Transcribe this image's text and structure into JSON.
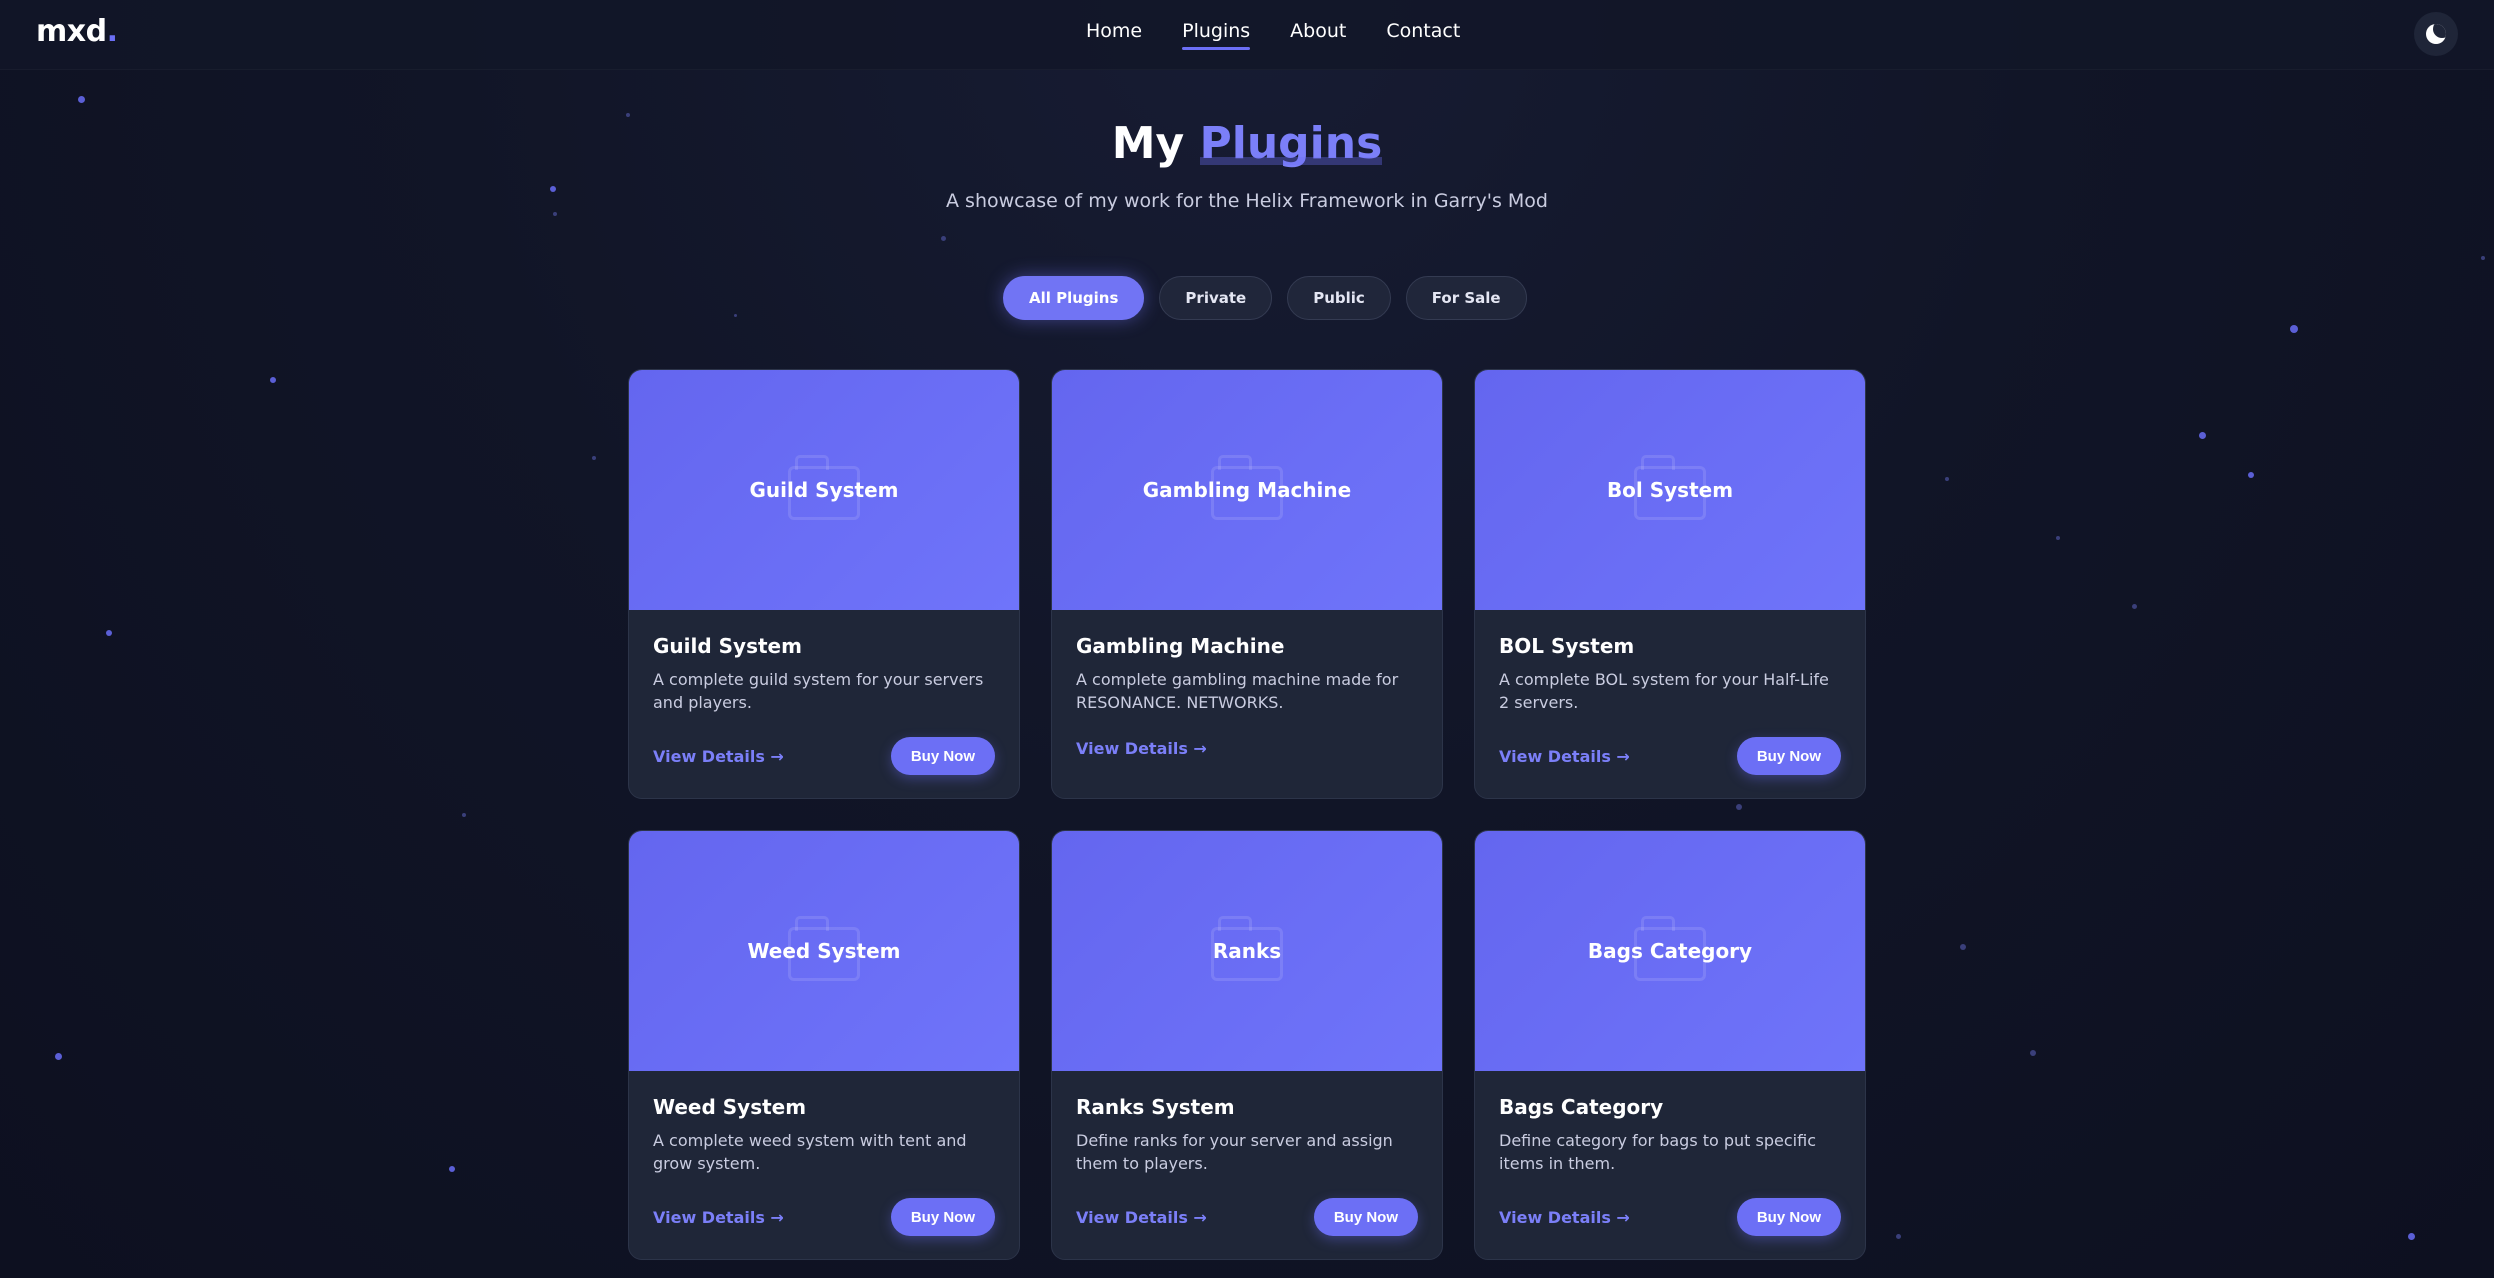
{
  "header": {
    "logo_text": "mxd",
    "logo_dot": ".",
    "nav": [
      {
        "label": "Home",
        "active": false
      },
      {
        "label": "Plugins",
        "active": true
      },
      {
        "label": "About",
        "active": false
      },
      {
        "label": "Contact",
        "active": false
      }
    ],
    "theme_icon": "moon-icon"
  },
  "hero": {
    "title_prefix": "My",
    "title_accent": "Plugins",
    "subtitle": "A showcase of my work for the Helix Framework in Garry's Mod"
  },
  "filters": [
    {
      "label": "All Plugins",
      "active": true
    },
    {
      "label": "Private",
      "active": false
    },
    {
      "label": "Public",
      "active": false
    },
    {
      "label": "For Sale",
      "active": false
    }
  ],
  "colors": {
    "accent": "#6c6ff5",
    "card_bg": "#1f2638",
    "page_bg": "#111527"
  },
  "cards": [
    {
      "banner": "Guild System",
      "title": "Guild System",
      "desc": "A complete guild system for your servers and players.",
      "view": "View Details →",
      "buy": "Buy Now"
    },
    {
      "banner": "Gambling Machine",
      "title": "Gambling Machine",
      "desc": "A complete gambling machine made for RESONANCE. NETWORKS.",
      "view": "View Details →",
      "buy": ""
    },
    {
      "banner": "Bol System",
      "title": "BOL System",
      "desc": "A complete BOL system for your Half-Life 2 servers.",
      "view": "View Details →",
      "buy": "Buy Now"
    },
    {
      "banner": "Weed System",
      "title": "Weed System",
      "desc": "A complete weed system with tent and grow system.",
      "view": "View Details →",
      "buy": "Buy Now"
    },
    {
      "banner": "Ranks",
      "title": "Ranks System",
      "desc": "Define ranks for your server and assign them to players.",
      "view": "View Details →",
      "buy": "Buy Now"
    },
    {
      "banner": "Bags Category",
      "title": "Bags Category",
      "desc": "Define category for bags to put specific items in them.",
      "view": "View Details →",
      "buy": "Buy Now"
    }
  ]
}
